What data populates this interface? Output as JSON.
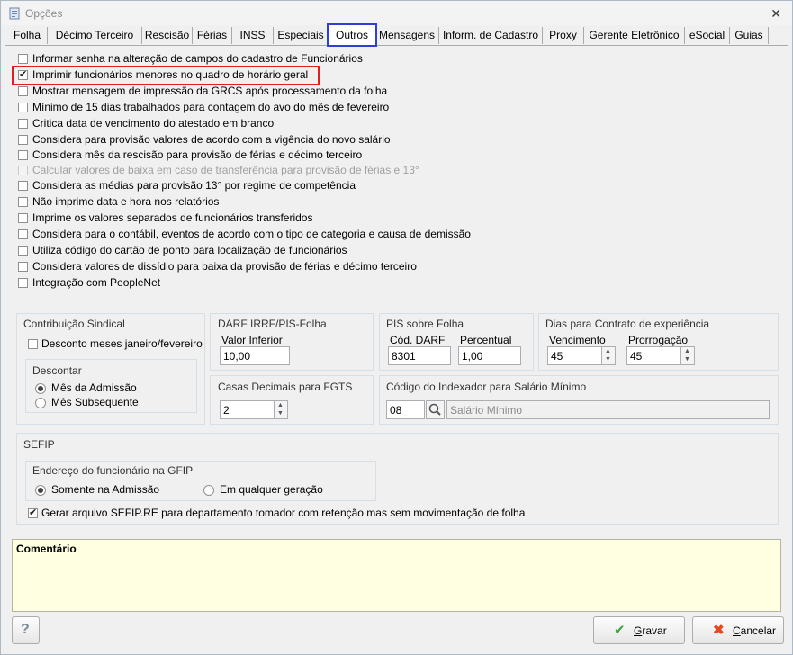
{
  "window": {
    "title": "Opções",
    "close_glyph": "✕"
  },
  "tabs": [
    {
      "label": "Folha"
    },
    {
      "label": "Décimo Terceiro"
    },
    {
      "label": "Rescisão"
    },
    {
      "label": "Férias"
    },
    {
      "label": "INSS"
    },
    {
      "label": "Especiais"
    },
    {
      "label": "Outros"
    },
    {
      "label": "Mensagens"
    },
    {
      "label": "Inform. de Cadastro"
    },
    {
      "label": "Proxy"
    },
    {
      "label": "Gerente Eletrônico"
    },
    {
      "label": "eSocial"
    },
    {
      "label": "Guias"
    }
  ],
  "active_tab": "Outros",
  "options": [
    {
      "label": "Informar senha na alteração de campos do cadastro de Funcionários",
      "checked": false,
      "enabled": true
    },
    {
      "label": "Imprimir funcionários menores no quadro de horário geral",
      "checked": true,
      "enabled": true
    },
    {
      "label": "Mostrar mensagem de impressão da GRCS após processamento da folha",
      "checked": false,
      "enabled": true
    },
    {
      "label": "Mínimo de 15 dias trabalhados para contagem do avo do mês de fevereiro",
      "checked": false,
      "enabled": true
    },
    {
      "label": "Critica data de vencimento do atestado em branco",
      "checked": false,
      "enabled": true
    },
    {
      "label": "Considera para provisão valores de acordo com a vigência do novo salário",
      "checked": false,
      "enabled": true
    },
    {
      "label": "Considera mês da rescisão para provisão de férias e décimo terceiro",
      "checked": false,
      "enabled": true
    },
    {
      "label": "Calcular valores de baixa em caso de transferência para provisão de férias e 13°",
      "checked": false,
      "enabled": false
    },
    {
      "label": "Considera as médias para provisão 13° por regime de competência",
      "checked": false,
      "enabled": true
    },
    {
      "label": "Não imprime data e hora nos relatórios",
      "checked": false,
      "enabled": true
    },
    {
      "label": "Imprime os valores separados de funcionários transferidos",
      "checked": false,
      "enabled": true
    },
    {
      "label": "Considera para o contábil, eventos de acordo com o tipo de categoria e causa de demissão",
      "checked": false,
      "enabled": true
    },
    {
      "label": "Utiliza código do cartão de ponto para localização de funcionários",
      "checked": false,
      "enabled": true
    },
    {
      "label": "Considera valores de dissídio para baixa da provisão de férias e décimo terceiro",
      "checked": false,
      "enabled": true
    },
    {
      "label": "Integração com PeopleNet",
      "checked": false,
      "enabled": true
    }
  ],
  "contribuicao": {
    "title": "Contribuição Sindical",
    "desconto_label": "Desconto meses janeiro/fevereiro",
    "descontar_title": "Descontar",
    "radio1": "Mês da Admissão",
    "radio2": "Mês Subsequente"
  },
  "darf": {
    "title": "DARF IRRF/PIS-Folha",
    "valor_label": "Valor Inferior",
    "valor": "10,00"
  },
  "pis": {
    "title": "PIS sobre Folha",
    "cod_label": "Cód. DARF",
    "cod": "8301",
    "perc_label": "Percentual",
    "perc": "1,00"
  },
  "dias": {
    "title": "Dias para Contrato de experiência",
    "venc_label": "Vencimento",
    "venc": "45",
    "prorr_label": "Prorrogação",
    "prorr": "45"
  },
  "casas": {
    "title": "Casas Decimais para FGTS",
    "value": "2"
  },
  "indexador": {
    "title": "Código do Indexador para Salário Mínimo",
    "code": "08",
    "desc": "Salário Mínimo"
  },
  "sefip": {
    "title": "SEFIP",
    "endereco_title": "Endereço do funcionário na GFIP",
    "radio1": "Somente na Admissão",
    "radio2": "Em qualquer geração",
    "gerar_label": "Gerar arquivo SEFIP.RE para departamento tomador com retenção mas sem movimentação de folha"
  },
  "comment": {
    "label": "Comentário"
  },
  "buttons": {
    "help": "?",
    "gravar_u": "G",
    "gravar_rest": "ravar",
    "cancelar_u": "C",
    "cancelar_rest": "ancelar"
  },
  "colors": {
    "accent_tab": "#2d3fd6",
    "highlight": "#e02020",
    "comment_bg": "#ffffe1"
  }
}
